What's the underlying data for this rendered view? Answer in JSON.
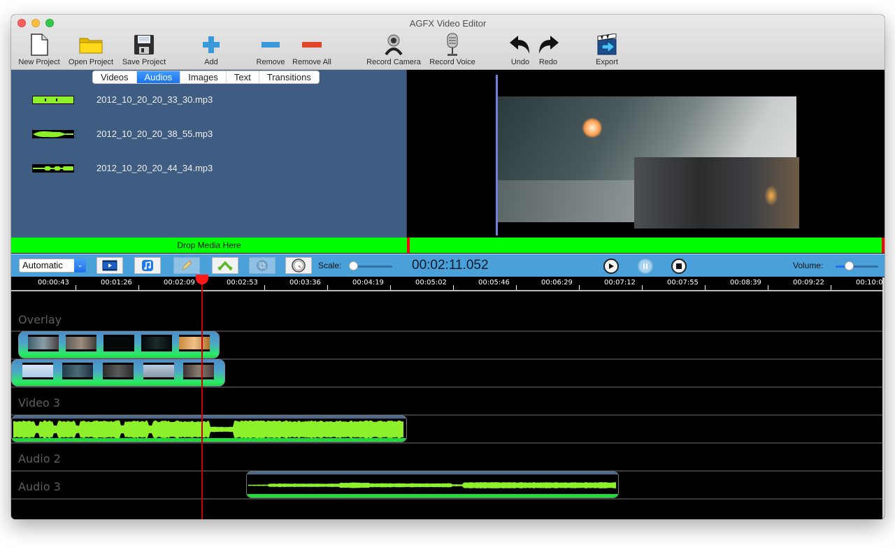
{
  "window": {
    "title": "AGFX Video Editor"
  },
  "toolbar": {
    "items": [
      {
        "label": "New Project",
        "icon": "new-document-icon"
      },
      {
        "label": "Open Project",
        "icon": "folder-icon"
      },
      {
        "label": "Save Project",
        "icon": "floppy-disk-icon"
      },
      {
        "label": "Add",
        "icon": "plus-icon"
      },
      {
        "label": "Remove",
        "icon": "minus-icon"
      },
      {
        "label": "Remove All",
        "icon": "remove-all-icon"
      },
      {
        "label": "Record Camera",
        "icon": "webcam-icon"
      },
      {
        "label": "Record Voice",
        "icon": "microphone-icon"
      },
      {
        "label": "Undo",
        "icon": "undo-icon"
      },
      {
        "label": "Redo",
        "icon": "redo-icon"
      },
      {
        "label": "Export",
        "icon": "export-icon"
      }
    ]
  },
  "media": {
    "tabs": [
      {
        "label": "Videos",
        "active": false
      },
      {
        "label": "Audios",
        "active": true
      },
      {
        "label": "Images",
        "active": false
      },
      {
        "label": "Text",
        "active": false
      },
      {
        "label": "Transitions",
        "active": false
      }
    ],
    "files": [
      {
        "name": "2012_10_20_20_33_30.mp3",
        "icon": "audio-waveform-icon"
      },
      {
        "name": "2012_10_20_20_38_55.mp3",
        "icon": "audio-waveform-icon"
      },
      {
        "name": "2012_10_20_20_44_34.mp3",
        "icon": "audio-waveform-icon"
      }
    ],
    "drop_label": "Drop Media Here"
  },
  "controls": {
    "mode_select": "Automatic",
    "buttons": [
      {
        "name": "add-video-track-button",
        "icon": "film-icon"
      },
      {
        "name": "add-audio-track-button",
        "icon": "music-note-icon"
      },
      {
        "name": "edit-button",
        "icon": "pencil-icon",
        "disabled": true
      },
      {
        "name": "split-button",
        "icon": "split-arrows-icon"
      },
      {
        "name": "overlay-button",
        "icon": "layers-icon",
        "disabled": true
      },
      {
        "name": "speed-button",
        "icon": "clock-icon"
      }
    ],
    "scale_label": "Scale:",
    "scale_value": 0.0,
    "timecode": "00:02:11.052",
    "volume_label": "Volume:",
    "volume_value": 0.3
  },
  "ruler": {
    "ticks": [
      "00:00:43",
      "00:01:26",
      "00:02:09",
      "00:02:53",
      "00:03:36",
      "00:04:19",
      "00:05:02",
      "00:05:46",
      "00:06:29",
      "00:07:12",
      "00:07:55",
      "00:08:39",
      "00:09:22",
      "00:10:0"
    ]
  },
  "tracks": {
    "labels": {
      "overlay": "Overlay",
      "video3": "Video 3",
      "audio2": "Audio 2",
      "audio3": "Audio 3"
    }
  },
  "colors": {
    "accent_blue": "#4aa0d8",
    "drop_green": "#00ff00",
    "wave_green": "#8ef02a",
    "playhead_red": "#cc0000",
    "media_panel": "#3f5c82"
  }
}
